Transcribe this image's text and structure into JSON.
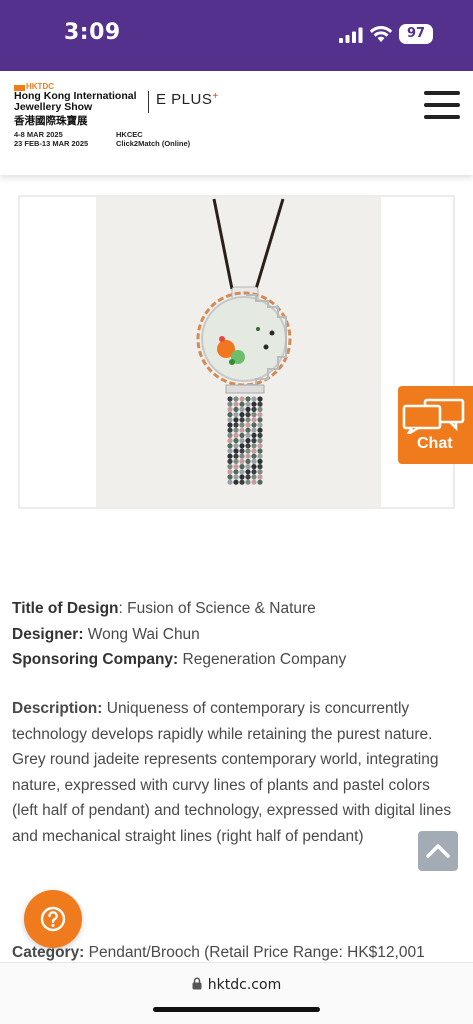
{
  "status_bar": {
    "time": "3:09",
    "battery": "97"
  },
  "header": {
    "logo_tag": "HKTDC",
    "show_name_en": "Hong Kong International Jewellery Show",
    "show_name_zh": "香港國際珠寶展",
    "eplus_label": "E PLUS",
    "dates": [
      "4-8 MAR 2025",
      "23 FEB-13 MAR 2025"
    ],
    "venues": [
      "HKCEC",
      "Click2Match (Online)"
    ],
    "menu_icon": "hamburger-icon"
  },
  "chat": {
    "label": "Chat",
    "icon": "chat-bubbles-icon"
  },
  "details": {
    "title_label": "Title of Design",
    "title_value": ": Fusion of Science & Nature",
    "designer_label": "Designer:",
    "designer_value": " Wong Wai Chun",
    "sponsor_label": "Sponsoring Company:",
    "sponsor_value": " Regeneration Company",
    "description_label": "Description:",
    "description_value": " Uniqueness of contemporary is concurrently technology develops rapidly while retaining the purest nature. Grey round jadeite represents contemporary world, integrating nature, expressed with curvy lines of plants and pastel colors (left half of pendant) and technology, expressed with digital lines and mechanical straight lines (right half of pendant)",
    "category_label": "Category:",
    "category_value": " Pendant/Brooch (Retail Price Range: HK$12,001"
  },
  "browser": {
    "url": "hktdc.com"
  },
  "colors": {
    "brand_purple": "#53318c",
    "accent_orange": "#f07b1d",
    "to_top_grey": "#9aa3ad"
  }
}
